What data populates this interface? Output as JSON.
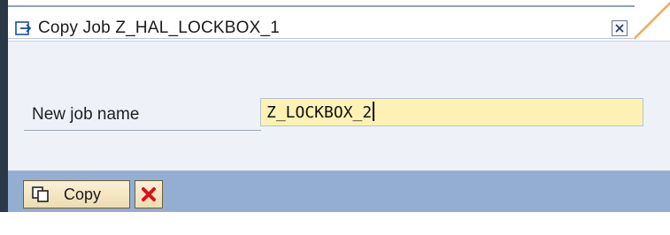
{
  "dialog": {
    "title": "Copy Job Z_HAL_LOCKBOX_1"
  },
  "form": {
    "label": "New job name",
    "value": "Z_LOCKBOX_2"
  },
  "buttons": {
    "copy_label": "Copy"
  },
  "icons": {
    "title": "copy-dialog-icon",
    "close": "close-icon",
    "copy": "copy-icon",
    "cancel": "cancel-icon"
  },
  "colors": {
    "input_background": "#fdf2b4",
    "button_bar": "#94aed3",
    "content_background": "#eef2f8",
    "cancel_red": "#d8101c"
  }
}
